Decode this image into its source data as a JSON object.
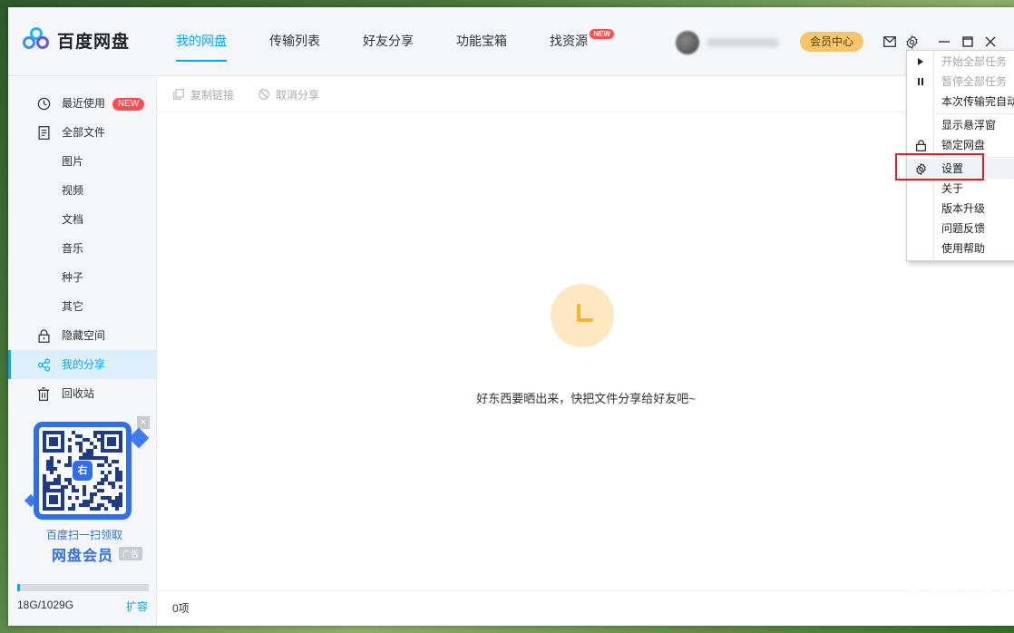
{
  "app": {
    "name": "百度网盘"
  },
  "nav": {
    "items": [
      {
        "label": "我的网盘",
        "active": true
      },
      {
        "label": "传输列表"
      },
      {
        "label": "好友分享"
      },
      {
        "label": "功能宝箱"
      },
      {
        "label": "找资源",
        "badge": "NEW"
      }
    ]
  },
  "header": {
    "vip_label": "会员中心"
  },
  "sidebar": {
    "items": [
      {
        "label": "最近使用",
        "icon": "clock-icon",
        "badge": "NEW"
      },
      {
        "label": "全部文件",
        "icon": "document-icon"
      },
      {
        "label": "图片"
      },
      {
        "label": "视频"
      },
      {
        "label": "文档"
      },
      {
        "label": "音乐"
      },
      {
        "label": "种子"
      },
      {
        "label": "其它"
      },
      {
        "label": "隐藏空间",
        "icon": "lock-icon"
      },
      {
        "label": "我的分享",
        "icon": "share-icon",
        "active": true
      },
      {
        "label": "回收站",
        "icon": "trash-icon"
      }
    ],
    "ad": {
      "qr_badge": "右",
      "line1": "百度扫一扫领取",
      "line2": "网盘会员",
      "tag": "广告",
      "close": "×"
    },
    "quota": {
      "text": "18G/1029G",
      "expand": "扩容",
      "used_fraction": 0.0175
    }
  },
  "toolbar": {
    "copy_link": "复制链接",
    "cancel_share": "取消分享"
  },
  "content": {
    "empty_message": "好东西要晒出来，快把文件分享给好友吧~"
  },
  "statusbar": {
    "count": "0项"
  },
  "menu": {
    "items": [
      {
        "label": "开始全部任务",
        "disabled": true,
        "icon": "play-icon"
      },
      {
        "label": "暂停全部任务",
        "disabled": true,
        "icon": "pause-icon"
      },
      {
        "label": "本次传输完自动关机"
      },
      {
        "label": "显示悬浮窗"
      },
      {
        "label": "锁定网盘",
        "icon": "lock-icon"
      },
      {
        "label": "设置",
        "icon": "gear-icon",
        "hover": true
      },
      {
        "label": "关于"
      },
      {
        "label": "版本升级"
      },
      {
        "label": "问题反馈"
      },
      {
        "label": "使用帮助"
      }
    ]
  },
  "colors": {
    "accent": "#06a7ff",
    "badge": "#ff4d4f",
    "vip": "#f8c56a",
    "highlight": "#e02020"
  }
}
